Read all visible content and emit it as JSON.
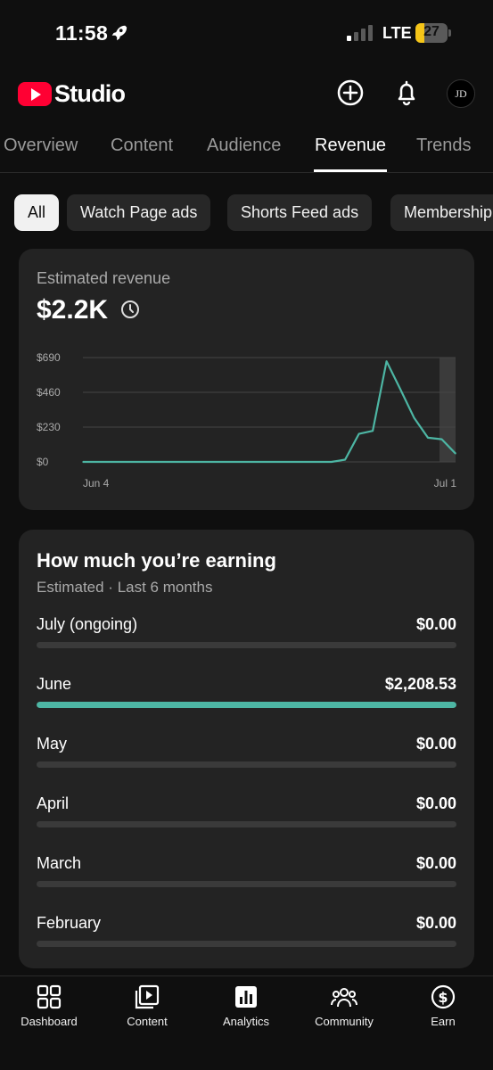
{
  "status_bar": {
    "time": "11:58",
    "network": "LTE",
    "battery": "27",
    "battery_level": 0.27
  },
  "header": {
    "app_name": "Studio",
    "avatar_initials": "JD"
  },
  "tabs": [
    {
      "label": "Overview",
      "active": false
    },
    {
      "label": "Content",
      "active": false
    },
    {
      "label": "Audience",
      "active": false
    },
    {
      "label": "Revenue",
      "active": true
    },
    {
      "label": "Trends",
      "active": false
    }
  ],
  "chips": [
    {
      "label": "All",
      "active": true
    },
    {
      "label": "Watch Page ads",
      "active": false
    },
    {
      "label": "Shorts Feed ads",
      "active": false
    },
    {
      "label": "Membership",
      "active": false
    }
  ],
  "revenue_card": {
    "title": "Estimated revenue",
    "value": "$2.2K"
  },
  "chart_data": {
    "type": "line",
    "title": "",
    "xlabel": "",
    "ylabel": "",
    "y_tick_labels": [
      "$690",
      "$460",
      "$230",
      "$0"
    ],
    "y_ticks": [
      690,
      460,
      230,
      0
    ],
    "ylim": [
      0,
      690
    ],
    "x_tick_labels": [
      "Jun 4",
      "Jul 1"
    ],
    "x": [
      "Jun 4",
      "Jun 5",
      "Jun 6",
      "Jun 7",
      "Jun 8",
      "Jun 9",
      "Jun 10",
      "Jun 11",
      "Jun 12",
      "Jun 13",
      "Jun 14",
      "Jun 15",
      "Jun 16",
      "Jun 17",
      "Jun 18",
      "Jun 19",
      "Jun 20",
      "Jun 21",
      "Jun 22",
      "Jun 23",
      "Jun 24",
      "Jun 25",
      "Jun 26",
      "Jun 27",
      "Jun 28",
      "Jun 29",
      "Jun 30",
      "Jul 1"
    ],
    "series": [
      {
        "values": [
          0,
          0,
          0,
          0,
          0,
          0,
          0,
          0,
          0,
          0,
          0,
          0,
          0,
          0,
          0,
          0,
          0,
          0,
          0,
          15,
          185,
          205,
          665,
          480,
          290,
          160,
          150,
          55
        ],
        "color": "#4db6a4"
      }
    ],
    "grid": true,
    "highlight_last_point": true
  },
  "earnings_card": {
    "title": "How much you’re earning",
    "subtitle": "Estimated · Last 6 months",
    "months": [
      {
        "month": "July (ongoing)",
        "amount": "$0.00",
        "fraction": 0
      },
      {
        "month": "June",
        "amount": "$2,208.53",
        "fraction": 1
      },
      {
        "month": "May",
        "amount": "$0.00",
        "fraction": 0
      },
      {
        "month": "April",
        "amount": "$0.00",
        "fraction": 0
      },
      {
        "month": "March",
        "amount": "$0.00",
        "fraction": 0
      },
      {
        "month": "February",
        "amount": "$0.00",
        "fraction": 0
      }
    ]
  },
  "bottom_nav": [
    {
      "label": "Dashboard",
      "icon": "dashboard-icon"
    },
    {
      "label": "Content",
      "icon": "content-icon"
    },
    {
      "label": "Analytics",
      "icon": "analytics-icon",
      "active": true
    },
    {
      "label": "Community",
      "icon": "community-icon"
    },
    {
      "label": "Earn",
      "icon": "earn-icon"
    }
  ],
  "colors": {
    "accent": "#4db6a4",
    "brand": "#ff0033",
    "background": "#0f0f0f",
    "card": "#232323"
  }
}
